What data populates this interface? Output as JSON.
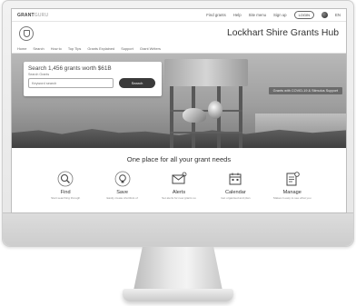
{
  "topbar": {
    "brand_bold": "GRANT",
    "brand_light": "GURU",
    "links": [
      "Find grants",
      "Help",
      "Site menu",
      "Sign up"
    ],
    "login_label": "LOGIN",
    "lang_label": "EN"
  },
  "header": {
    "title": "Lockhart Shire Grants Hub"
  },
  "nav": {
    "items": [
      "Home",
      "Search",
      "How to",
      "Top Tips",
      "Grants Explained",
      "Support",
      "Grant Writers"
    ]
  },
  "hero": {
    "search_title": "Search 1,456 grants worth $61B",
    "search_label": "Search Grants",
    "search_placeholder": "Keyword search",
    "search_button": "Search",
    "banner_text": "Grants with COVID-19 & Stimulus Support"
  },
  "tagline": "One place for all your grant needs",
  "features": [
    {
      "icon": "magnifier-icon",
      "label": "Find",
      "desc": "Start searching through"
    },
    {
      "icon": "bulb-icon",
      "label": "Save",
      "desc": "Easily create shortlists of"
    },
    {
      "icon": "envelope-icon",
      "label": "Alerts",
      "desc": "Set alerts for new grants so"
    },
    {
      "icon": "calendar-icon",
      "label": "Calendar",
      "desc": "Get organised and plan"
    },
    {
      "icon": "document-gear-icon",
      "label": "Manage",
      "desc": "Makes it easy to see what you"
    }
  ]
}
